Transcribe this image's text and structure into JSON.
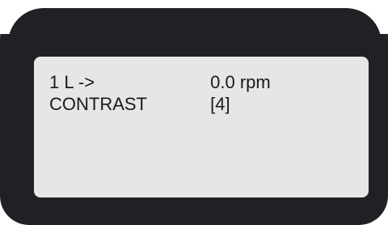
{
  "display": {
    "rows": [
      {
        "label": "1 L ->",
        "value": "0.0 rpm"
      },
      {
        "label": "CONTRAST",
        "value": "[4]"
      }
    ]
  },
  "colors": {
    "bezel": "#202124",
    "screen": "#e6e6e6",
    "text": "#1a1a1a"
  }
}
